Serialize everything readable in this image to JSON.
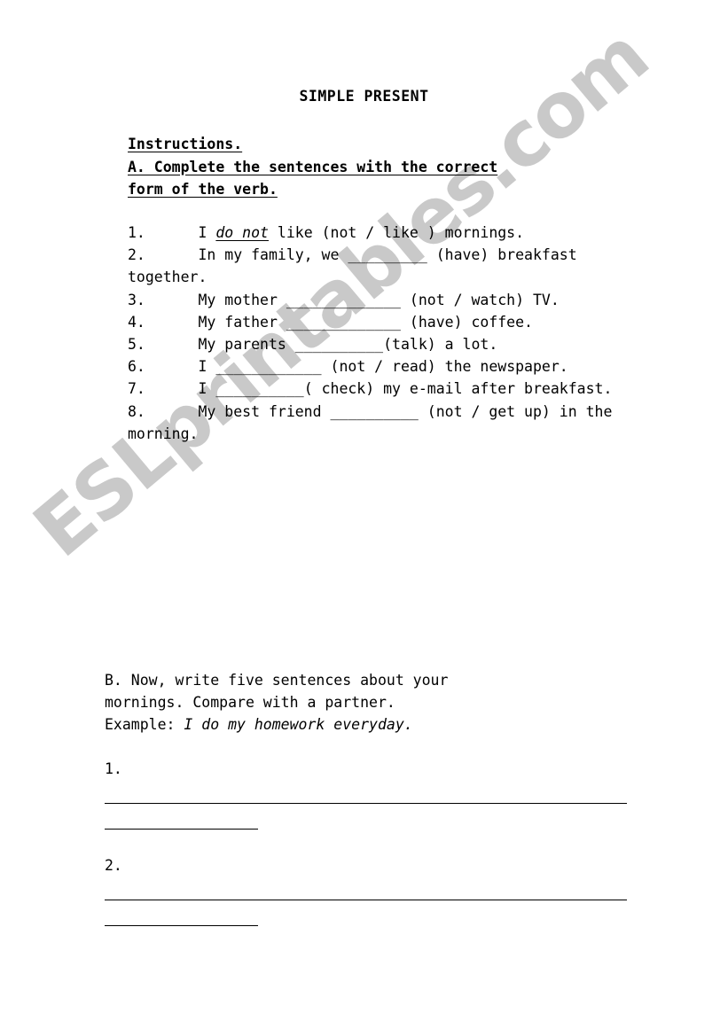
{
  "document": {
    "title": "SIMPLE PRESENT"
  },
  "instructions": {
    "heading": "Instructions.",
    "part_a_line1": "A. Complete the sentences with the correct",
    "part_a_line2": "form of the verb."
  },
  "part_a": {
    "items": [
      {
        "number": "1.",
        "pre": "      I ",
        "answer": "do not",
        "post": " like (not / like ) mornings."
      },
      {
        "number": "2.",
        "pre": "      In my family, we ",
        "blank": "_________",
        "post": " (have) breakfast together."
      },
      {
        "number": "3.",
        "pre": "      My mother ",
        "blank": "_____________",
        "post": " (not / watch) TV."
      },
      {
        "number": "4.",
        "pre": "      My father ",
        "blank": "_____________",
        "post": " (have) coffee."
      },
      {
        "number": "5.",
        "pre": "      My parents ",
        "blank": "__________",
        "post": "(talk) a lot."
      },
      {
        "number": "6.",
        "pre": "      I ",
        "blank": "____________",
        "post": " (not / read) the newspaper."
      },
      {
        "number": "7.",
        "pre": "      I ",
        "blank": "__________",
        "post": "( check) my e-mail after breakfast."
      },
      {
        "number": "8.",
        "pre": "      My best friend ",
        "blank": "__________",
        "post": " (not / get up) in the morning."
      }
    ]
  },
  "part_b": {
    "line1": "B. Now, write five sentences about your",
    "line2": "mornings. Compare with a partner.",
    "example_label": "Example: ",
    "example_text": "I do my homework everyday.",
    "answer_slots": [
      {
        "number": "1."
      },
      {
        "number": "2."
      }
    ]
  },
  "watermark": {
    "text": "ESLprintables.com",
    "color": "#c9c9c9"
  }
}
